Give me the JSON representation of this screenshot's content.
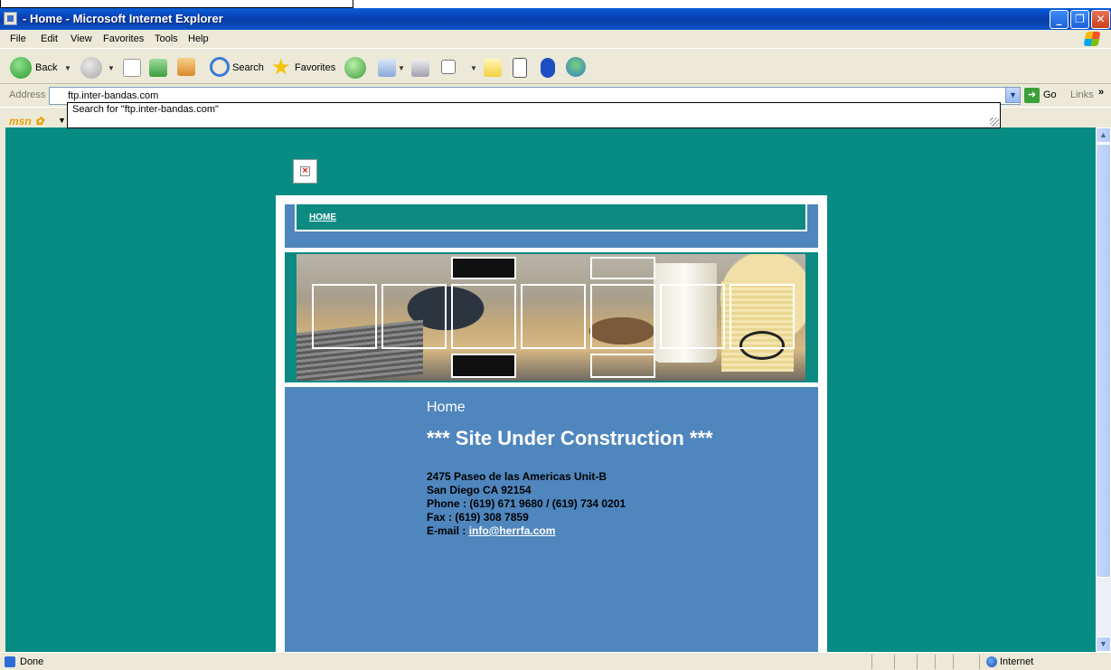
{
  "window": {
    "title": " - Home - Microsoft Internet Explorer",
    "minimize_icon": "minimize-icon",
    "maximize_icon": "restore-icon",
    "close_icon": "close-icon"
  },
  "menu": {
    "items": [
      "File",
      "Edit",
      "View",
      "Favorites",
      "Tools",
      "Help"
    ]
  },
  "toolbar": {
    "back_label": "Back",
    "search_label": "Search",
    "favorites_label": "Favorites"
  },
  "address_bar": {
    "label": "Address",
    "value": "ftp.inter-bandas.com",
    "go_label": "Go",
    "links_label": "Links",
    "links_chevron": "»"
  },
  "autocomplete": {
    "suggestion": "Search for \"ftp.inter-bandas.com\""
  },
  "msn": {
    "logo": "msn"
  },
  "page": {
    "nav_home": "HOME",
    "title": "Home",
    "headline": "*** Site Under Construction ***",
    "address_lines": [
      "2475 Paseo de las Americas Unit-B",
      "San Diego CA 92154",
      "Phone : (619) 671 9680 / (619) 734 0201",
      "Fax : (619) 308 7859"
    ],
    "email_label": "E-mail : ",
    "email_link": "info@herrfa.com",
    "broken_image_icon": "×"
  },
  "status_bar": {
    "status_text": "Done",
    "zone": "Internet"
  },
  "colors": {
    "page_background": "#078c84",
    "content_blue": "#4f86bd",
    "titlebar_blue": "#0842b8"
  }
}
